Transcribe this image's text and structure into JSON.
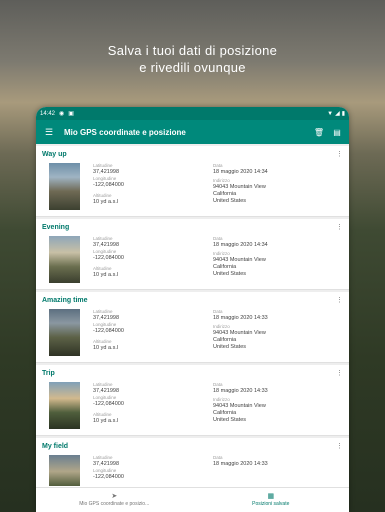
{
  "promo": {
    "line1": "Salva i tuoi dati di posizione",
    "line2": "e rivedili ovunque"
  },
  "statusbar": {
    "time": "14:42"
  },
  "appbar": {
    "title": "Mio GPS coordinate e posizione",
    "menu_icon": "menu-icon",
    "delete_icon": "delete-icon",
    "export_icon": "file-export-icon"
  },
  "labels": {
    "lat": "Latitudine",
    "lon": "Longitudine",
    "alt": "Altitudine",
    "date": "Data",
    "addr": "Indirizzo"
  },
  "items": [
    {
      "name": "Way up",
      "lat": "37,421998",
      "lon": "-122,084000",
      "alt": "10 yd a.s.l",
      "date": "18 maggio 2020 14:34",
      "a1": "94043 Mountain View",
      "a2": "California",
      "a3": "United States"
    },
    {
      "name": "Evening",
      "lat": "37,421998",
      "lon": "-122,084000",
      "alt": "10 yd a.s.l",
      "date": "18 maggio 2020 14:34",
      "a1": "94043 Mountain View",
      "a2": "California",
      "a3": "United States"
    },
    {
      "name": "Amazing time",
      "lat": "37,421998",
      "lon": "-122,084000",
      "alt": "10 yd a.s.l",
      "date": "18 maggio 2020 14:33",
      "a1": "94043 Mountain View",
      "a2": "California",
      "a3": "United States"
    },
    {
      "name": "Trip",
      "lat": "37,421998",
      "lon": "-122,084000",
      "alt": "10 yd a.s.l",
      "date": "18 maggio 2020 14:33",
      "a1": "94043 Mountain View",
      "a2": "California",
      "a3": "United States"
    },
    {
      "name": "My field",
      "lat": "37,421998",
      "lon": "-122,084000",
      "alt": "",
      "date": "18 maggio 2020 14:33",
      "a1": "",
      "a2": "",
      "a3": ""
    }
  ],
  "bottomnav": {
    "tab1": "Mio GPS coordinate e posizio...",
    "tab2": "Posizioni salvate"
  },
  "colors": {
    "primary": "#00897b",
    "primary_dark": "#00796b"
  }
}
